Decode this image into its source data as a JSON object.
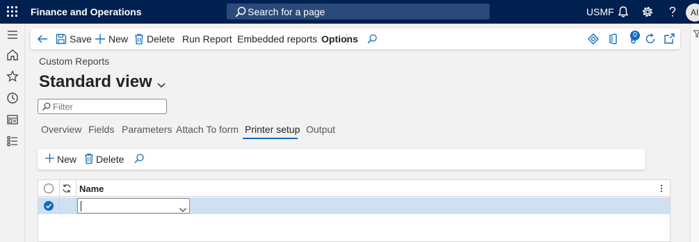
{
  "topbar": {
    "app_title": "Finance and Operations",
    "search_placeholder": "Search for a page",
    "company": "USMF",
    "avatar_initials": "AI"
  },
  "actionpane": {
    "save": "Save",
    "new": "New",
    "delete": "Delete",
    "run_report": "Run Report",
    "embedded_reports": "Embedded reports",
    "options": "Options",
    "notification_count": "0"
  },
  "form": {
    "caption": "Custom Reports",
    "view_name": "Standard view",
    "filter_placeholder": "Filter"
  },
  "tabs": [
    {
      "label": "Overview"
    },
    {
      "label": "Fields"
    },
    {
      "label": "Parameters"
    },
    {
      "label": "Attach To form"
    },
    {
      "label": "Printer setup"
    },
    {
      "label": "Output"
    }
  ],
  "active_tab": "Printer setup",
  "grid_toolbar": {
    "new": "New",
    "delete": "Delete"
  },
  "grid": {
    "columns": [
      "Name"
    ],
    "rows": [
      {
        "name": "",
        "selected": true
      }
    ]
  },
  "colors": {
    "nav_bar": "#002050",
    "accent": "#0f6cbd",
    "selected_row": "#cfe0f5"
  }
}
